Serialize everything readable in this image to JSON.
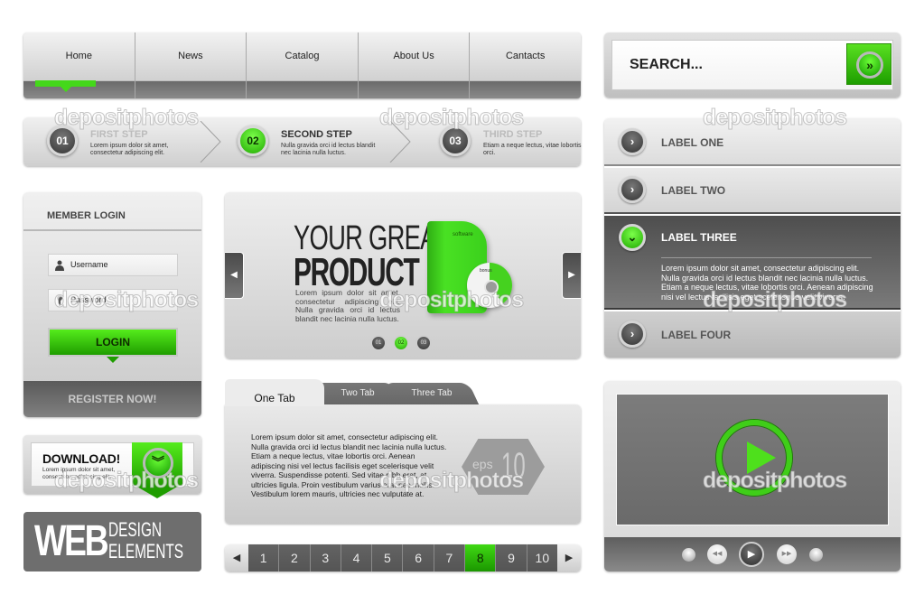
{
  "colors": {
    "accent_green": "#44d81a",
    "dark_gray": "#5a5a5a",
    "panel_light": "#e8e8e8"
  },
  "nav": {
    "items": [
      {
        "label": "Home",
        "active": true
      },
      {
        "label": "News",
        "active": false
      },
      {
        "label": "Catalog",
        "active": false
      },
      {
        "label": "About Us",
        "active": false
      },
      {
        "label": "Cantacts",
        "active": false
      }
    ]
  },
  "steps": {
    "items": [
      {
        "number": "01",
        "title": "FIRST STEP",
        "desc": "Lorem ipsum dolor sit amet, consectetur adipiscing elit.",
        "active": false
      },
      {
        "number": "02",
        "title": "SECOND STEP",
        "desc": "Nulla gravida orci id lectus blandit nec lacinia nulla luctus.",
        "active": true
      },
      {
        "number": "03",
        "title": "THIRD STEP",
        "desc": "Etiam a neque lectus, vitae lobortis orci.",
        "active": false
      }
    ]
  },
  "search": {
    "placeholder": "SEARCH...",
    "button_icon": "double-chevron-right-icon",
    "button_glyph": "»"
  },
  "accordion": {
    "items": [
      {
        "label": "LABEL ONE",
        "open": false,
        "glyph": "›"
      },
      {
        "label": "LABEL TWO",
        "open": false,
        "glyph": "›"
      },
      {
        "label": "LABEL THREE",
        "open": true,
        "glyph": "⌄",
        "body": "Lorem ipsum dolor sit amet, consectetur adipiscing elit. Nulla gravida orci id lectus blandit nec lacinia nulla luctus. Etiam a neque lectus, vitae lobortis orci. Aenean adipiscing nisi vel lectus facilisis eget scelerisque velit viverra."
      },
      {
        "label": "LABEL FOUR",
        "open": false,
        "glyph": "›"
      }
    ]
  },
  "login": {
    "title": "MEMBER LOGIN",
    "username_placeholder": "Username",
    "password_placeholder": "Password",
    "login_label": "LOGIN",
    "register_label": "REGISTER NOW!"
  },
  "slider": {
    "headline_1": "YOUR GREAT",
    "headline_2": "PRODUCT",
    "description": "Lorem ipsum dolor sit amet, consectetur adipiscing elit. Nulla gravida orci id lectus blandit nec lacinia nulla luctus.",
    "box_brand": "software",
    "disc_brand": "bonus",
    "prev_glyph": "◀",
    "next_glyph": "▶",
    "dots": [
      {
        "label": "01",
        "active": false
      },
      {
        "label": "02",
        "active": true
      },
      {
        "label": "03",
        "active": false
      }
    ]
  },
  "tabs": {
    "items": [
      {
        "label": "One Tab",
        "active": true
      },
      {
        "label": "Two Tab",
        "active": false
      },
      {
        "label": "Three Tab",
        "active": false
      }
    ],
    "content": "Lorem ipsum dolor sit amet, consectetur adipiscing elit. Nulla gravida orci id lectus blandit nec lacinia nulla luctus. Etiam a neque lectus, vitae lobortis orci. Aenean adipiscing nisi vel lectus facilisis eget scelerisque velit viverra. Suspendisse potenti. Sed vitae nibh erat, at ultricies ligula. Proin vestibulum varius erat nec mollis. Vestibulum lorem mauris, ultricies nec vulputate at.",
    "badge_prefix": "eps",
    "badge_number": "10"
  },
  "pagination": {
    "prev_glyph": "◀",
    "next_glyph": "▶",
    "pages": [
      "1",
      "2",
      "3",
      "4",
      "5",
      "6",
      "7",
      "8",
      "9",
      "10"
    ],
    "current": "8"
  },
  "download": {
    "title": "DOWNLOAD!",
    "subtitle": "Lorem ipsum dolor sit amet, consectetur adipiscing elit.",
    "icon_glyph": "︾"
  },
  "banner": {
    "big": "WEB",
    "line1": "DESIGN",
    "line2": "ELEMENTS"
  },
  "player": {
    "rewind_glyph": "◀◀",
    "play_glyph": "▶",
    "forward_glyph": "▶▶"
  },
  "watermark": {
    "text": "depositphotos"
  }
}
